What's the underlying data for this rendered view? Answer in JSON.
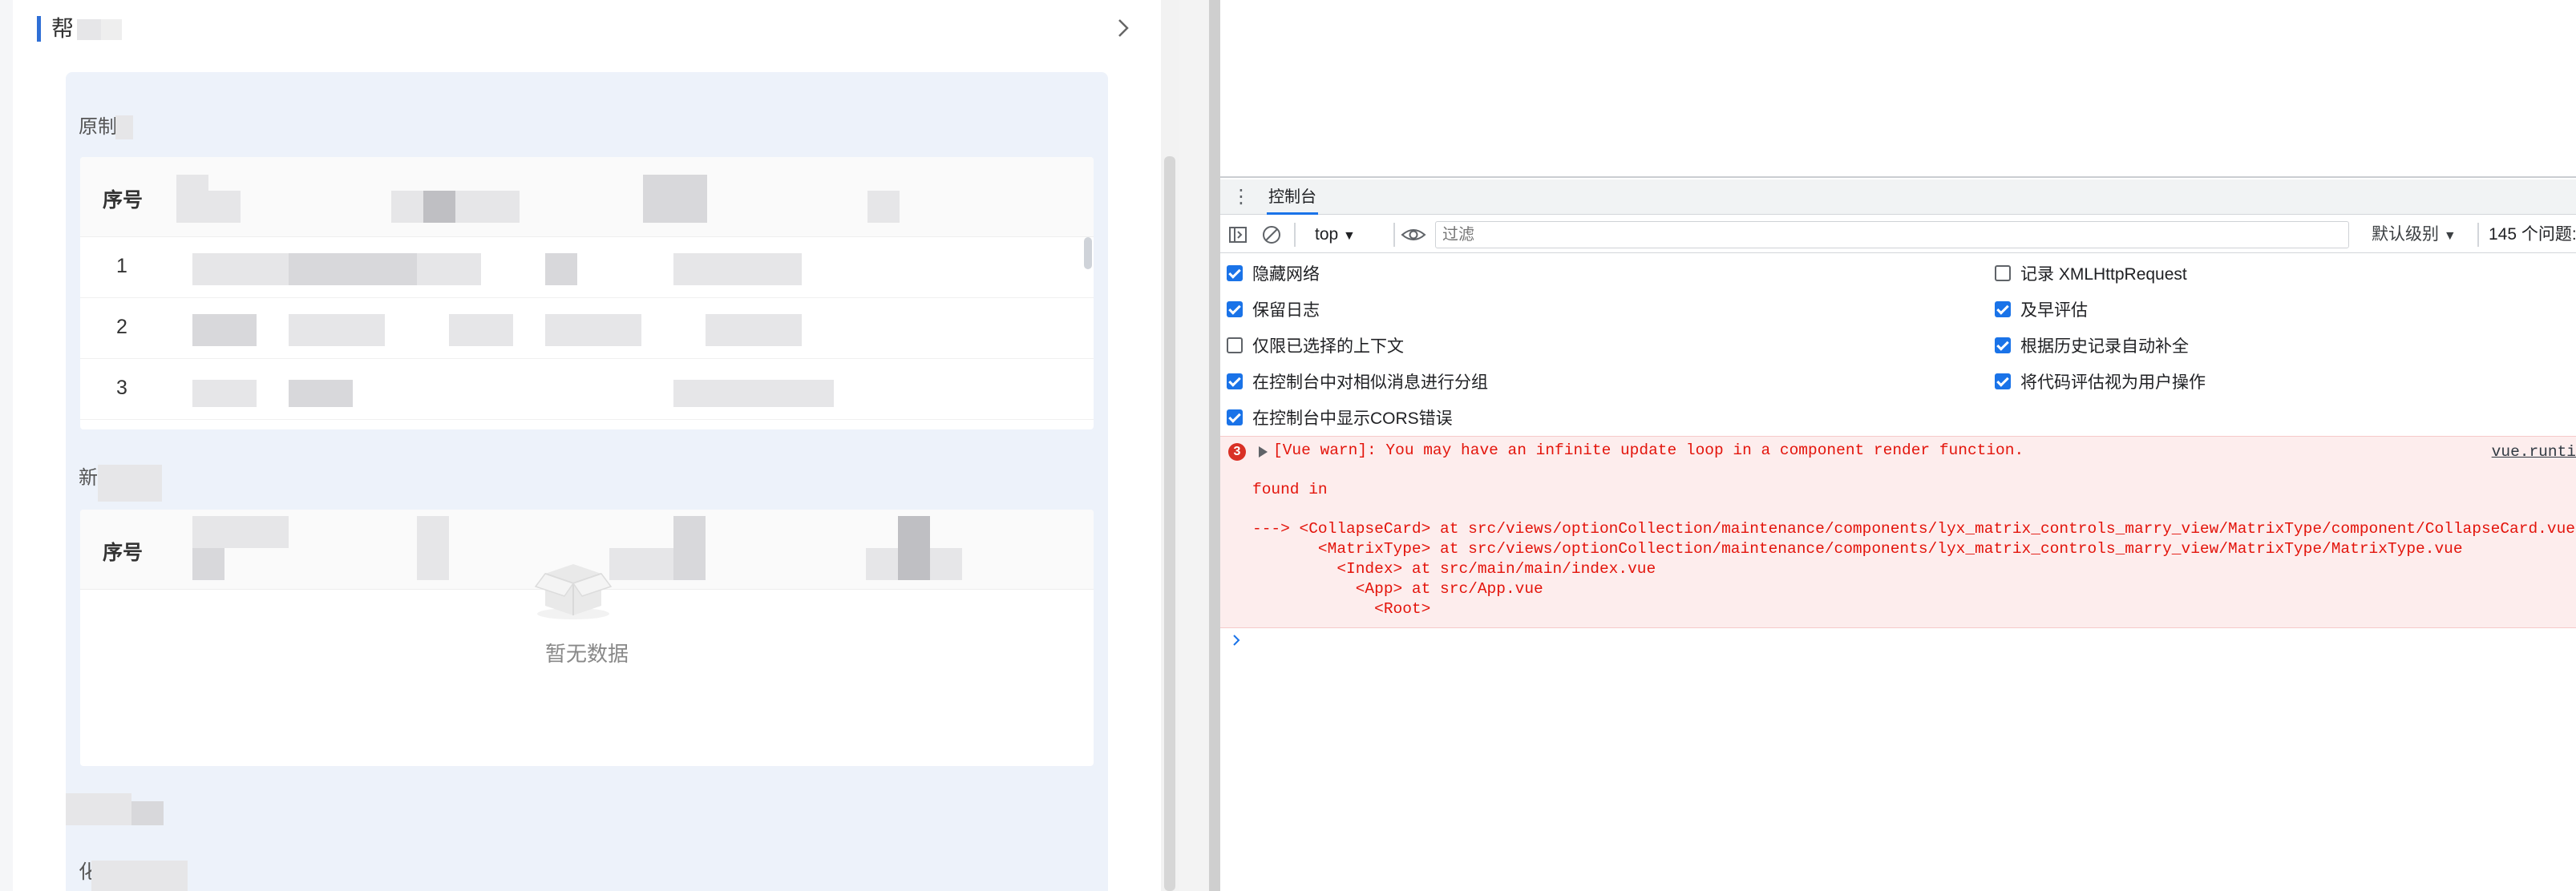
{
  "app": {
    "header_title": "帮",
    "section1": {
      "title": "原制",
      "col_index_header": "序号",
      "rows": [
        "1",
        "2",
        "3"
      ]
    },
    "section2": {
      "title": "新",
      "col_index_header": "序号",
      "empty_text": "暂无数据"
    },
    "section3": {
      "title": ""
    },
    "section4": {
      "title": "化"
    }
  },
  "devtools": {
    "drawer_tab": "控制台",
    "context": "top",
    "filter_placeholder": "过滤",
    "level": "默认级别",
    "issues": "145 个问题:",
    "settings_left": [
      {
        "label": "隐藏网络",
        "checked": true
      },
      {
        "label": "保留日志",
        "checked": true
      },
      {
        "label": "仅限已选择的上下文",
        "checked": false
      },
      {
        "label": "在控制台中对相似消息进行分组",
        "checked": true
      },
      {
        "label": "在控制台中显示CORS错误",
        "checked": true
      }
    ],
    "settings_right": [
      {
        "label": "记录 XMLHttpRequest",
        "checked": false
      },
      {
        "label": "及早评估",
        "checked": true
      },
      {
        "label": "根据历史记录自动补全",
        "checked": true
      },
      {
        "label": "将代码评估视为用户操作",
        "checked": true
      }
    ],
    "error": {
      "count": "3",
      "message": "[Vue warn]: You may have an infinite update loop in a component render function.",
      "source": "vue.runti",
      "found_in": "found in",
      "trace": [
        "---> <CollapseCard> at src/views/optionCollection/maintenance/components/lyx_matrix_controls_marry_view/MatrixType/component/CollapseCard.vue",
        "       <MatrixType> at src/views/optionCollection/maintenance/components/lyx_matrix_controls_marry_view/MatrixType/MatrixType.vue",
        "         <Index> at src/main/main/index.vue",
        "           <App> at src/App.vue",
        "             <Root>"
      ]
    },
    "colors": {
      "accent": "#1a73e8",
      "error_bg": "#fdeded",
      "error_text": "#e3140b"
    }
  }
}
